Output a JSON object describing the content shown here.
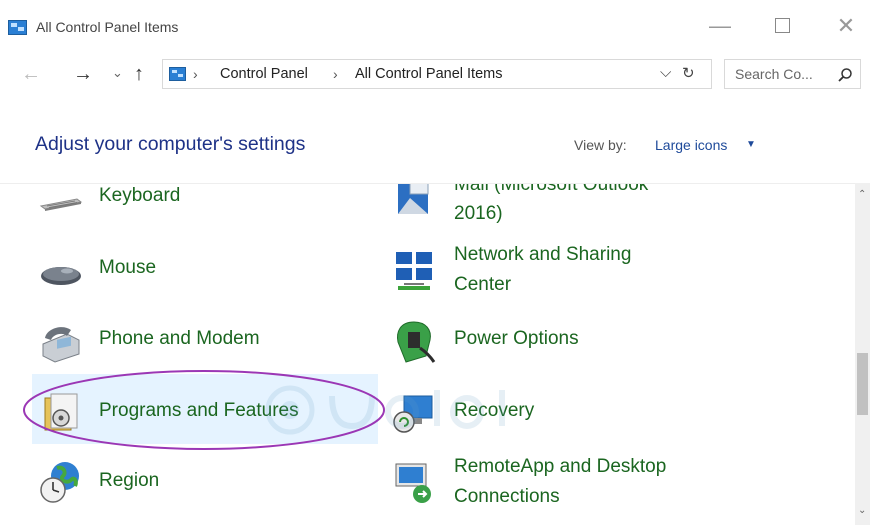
{
  "window": {
    "title": "All Control Panel Items",
    "minimize": "—",
    "close": "✕"
  },
  "nav": {
    "back": "←",
    "forward": "→",
    "recent": "⌄",
    "up": "↑",
    "breadcrumb": [
      "Control Panel",
      "All Control Panel Items"
    ],
    "separator": "›",
    "dropdown": "⌵",
    "refresh": "↻",
    "search_placeholder": "Search Co..."
  },
  "header": {
    "title": "Adjust your computer's settings",
    "view_by_label": "View by:",
    "view_by_value": "Large icons",
    "view_by_arrow": "▼"
  },
  "items_left": [
    {
      "label": "Keyboard",
      "icon": "keyboard-icon"
    },
    {
      "label": "Mouse",
      "icon": "mouse-icon"
    },
    {
      "label": "Phone and Modem",
      "icon": "phone-icon"
    },
    {
      "label": "Programs and Features",
      "icon": "programs-icon"
    },
    {
      "label": "Region",
      "icon": "region-icon"
    }
  ],
  "items_right": [
    {
      "label_line1": "Mail (Microsoft Outlook",
      "label_line2": "2016)",
      "icon": "mail-icon"
    },
    {
      "label_line1": "Network and Sharing",
      "label_line2": "Center",
      "icon": "network-icon"
    },
    {
      "label": "Power Options",
      "icon": "power-icon"
    },
    {
      "label": "Recovery",
      "icon": "recovery-icon"
    },
    {
      "label_line1": "RemoteApp and Desktop",
      "label_line2": "Connections",
      "icon": "remoteapp-icon"
    }
  ],
  "scrollbar": {
    "up": "⌃",
    "down": "⌄"
  },
  "colors": {
    "link_green": "#1b6620",
    "title_blue": "#1e3287",
    "highlight": "#e5f3ff",
    "annotation_purple": "#9b37b5"
  }
}
